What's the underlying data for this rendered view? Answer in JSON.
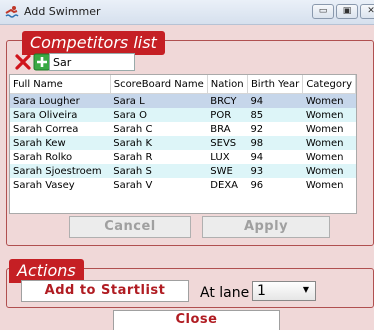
{
  "window": {
    "title": "Add Swimmer",
    "minimize": "▭",
    "maximize": "▣",
    "close": "✕"
  },
  "competitors": {
    "group_title": "Competitors list",
    "search_value": "Sar",
    "columns": [
      "Full Name",
      "ScoreBoard Name",
      "Nation",
      "Birth Year",
      "Category"
    ],
    "rows": [
      [
        "Sara Lougher",
        "Sara L",
        "BRCY",
        "94",
        "Women"
      ],
      [
        "Sara Oliveira",
        "Sara O",
        "POR",
        "85",
        "Women"
      ],
      [
        "Sarah Correa",
        "Sarah C",
        "BRA",
        "92",
        "Women"
      ],
      [
        "Sarah Kew",
        "Sarah K",
        "SEVS",
        "98",
        "Women"
      ],
      [
        "Sarah Rolko",
        "Sarah R",
        "LUX",
        "94",
        "Women"
      ],
      [
        "Sarah Sjoestroem",
        "Sarah S",
        "SWE",
        "93",
        "Women"
      ],
      [
        "Sarah Vasey",
        "Sarah V",
        "DEXA",
        "96",
        "Women"
      ]
    ],
    "cancel_label": "Cancel",
    "apply_label": "Apply"
  },
  "actions": {
    "group_title": "Actions",
    "add_label": "Add to Startlist",
    "lane_label": "At lane",
    "lane_value": "1"
  },
  "close_label": "Close"
}
